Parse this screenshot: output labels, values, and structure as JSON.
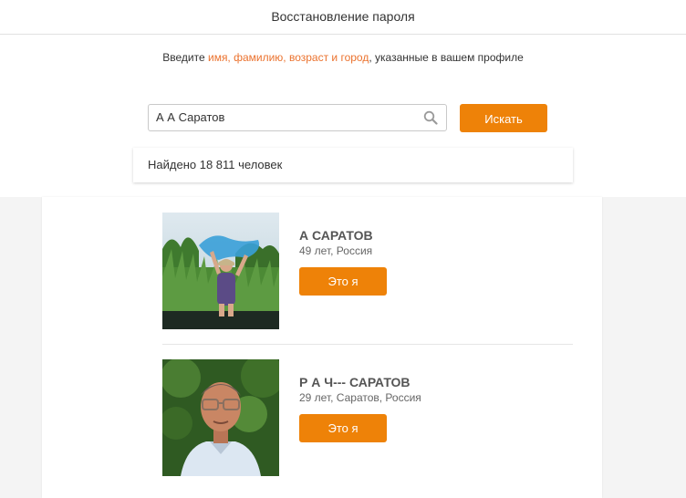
{
  "header": {
    "title": "Восстановление пароля"
  },
  "instructions": {
    "before": "Введите ",
    "highlight": "имя, фамилию, возраст и город",
    "after": ", указанные в вашем профиле"
  },
  "search": {
    "value": "А А Саратов",
    "icon": "search-icon",
    "button_label": "Искать"
  },
  "found": {
    "text": "Найдено 18 811 человек"
  },
  "results": [
    {
      "name": "А САРАТОВ",
      "info": "49 лет, Россия",
      "button_label": "Это я"
    },
    {
      "name": "Р А Ч--- САРАТОВ",
      "info": "29 лет, Саратов, Россия",
      "button_label": "Это я"
    }
  ],
  "colors": {
    "accent": "#ee8208",
    "highlight_text": "#eb722e"
  }
}
